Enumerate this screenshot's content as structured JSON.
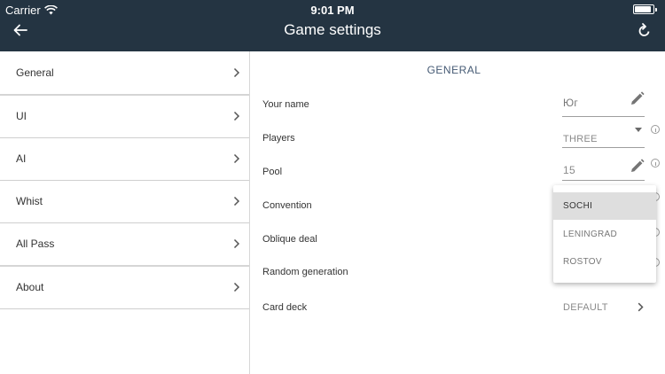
{
  "status_bar": {
    "carrier": "Carrier",
    "time": "9:01 PM",
    "battery_level": 0.9
  },
  "header": {
    "title": "Game settings",
    "back_icon": "arrow-left-icon",
    "reset_icon": "refresh-icon"
  },
  "sidebar": {
    "items": [
      {
        "label": "General"
      },
      {
        "label": "UI"
      },
      {
        "label": "AI"
      },
      {
        "label": "Whist"
      },
      {
        "label": "All Pass"
      },
      {
        "label": "About"
      }
    ]
  },
  "main": {
    "section_title": "GENERAL",
    "rows": {
      "name": {
        "label": "Your name",
        "value": "Юг"
      },
      "players": {
        "label": "Players",
        "value": "THREE"
      },
      "pool": {
        "label": "Pool",
        "value": "15"
      },
      "convention": {
        "label": "Convention"
      },
      "oblique": {
        "label": "Oblique deal"
      },
      "random": {
        "label": "Random generation"
      },
      "deck": {
        "label": "Card deck",
        "value": "DEFAULT"
      }
    }
  },
  "convention_dropdown": {
    "options": [
      "SOCHI",
      "LENINGRAD",
      "ROSTOV"
    ],
    "selected": "SOCHI"
  },
  "colors": {
    "header_bg": "#243442",
    "section_title": "#455a74",
    "selected_option_bg": "#dedede"
  }
}
